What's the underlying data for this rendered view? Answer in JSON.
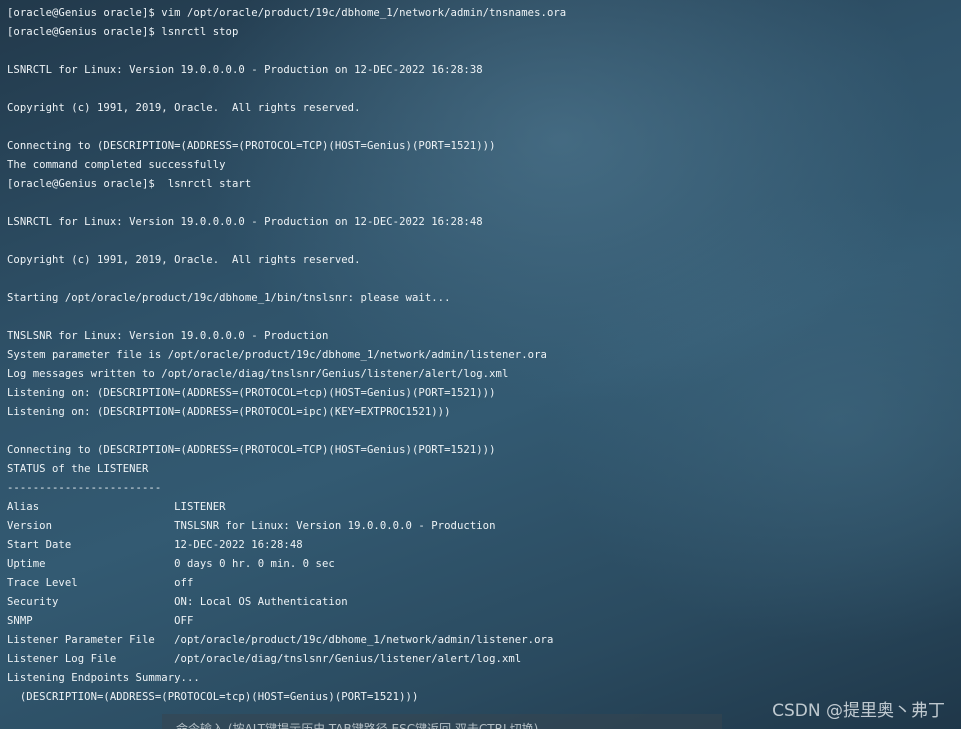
{
  "terminal": {
    "lines": [
      "[oracle@Genius oracle]$ vim /opt/oracle/product/19c/dbhome_1/network/admin/tnsnames.ora",
      "[oracle@Genius oracle]$ lsnrctl stop",
      "",
      "LSNRCTL for Linux: Version 19.0.0.0.0 - Production on 12-DEC-2022 16:28:38",
      "",
      "Copyright (c) 1991, 2019, Oracle.  All rights reserved.",
      "",
      "Connecting to (DESCRIPTION=(ADDRESS=(PROTOCOL=TCP)(HOST=Genius)(PORT=1521)))",
      "The command completed successfully",
      "[oracle@Genius oracle]$  lsnrctl start",
      "",
      "LSNRCTL for Linux: Version 19.0.0.0.0 - Production on 12-DEC-2022 16:28:48",
      "",
      "Copyright (c) 1991, 2019, Oracle.  All rights reserved.",
      "",
      "Starting /opt/oracle/product/19c/dbhome_1/bin/tnslsnr: please wait...",
      "",
      "TNSLSNR for Linux: Version 19.0.0.0.0 - Production",
      "System parameter file is /opt/oracle/product/19c/dbhome_1/network/admin/listener.ora",
      "Log messages written to /opt/oracle/diag/tnslsnr/Genius/listener/alert/log.xml",
      "Listening on: (DESCRIPTION=(ADDRESS=(PROTOCOL=tcp)(HOST=Genius)(PORT=1521)))",
      "Listening on: (DESCRIPTION=(ADDRESS=(PROTOCOL=ipc)(KEY=EXTPROC1521)))",
      "",
      "Connecting to (DESCRIPTION=(ADDRESS=(PROTOCOL=TCP)(HOST=Genius)(PORT=1521)))",
      "STATUS of the LISTENER",
      "------------------------",
      "Alias                     LISTENER",
      "Version                   TNSLSNR for Linux: Version 19.0.0.0.0 - Production",
      "Start Date                12-DEC-2022 16:28:48",
      "Uptime                    0 days 0 hr. 0 min. 0 sec",
      "Trace Level               off",
      "Security                  ON: Local OS Authentication",
      "SNMP                      OFF",
      "Listener Parameter File   /opt/oracle/product/19c/dbhome_1/network/admin/listener.ora",
      "Listener Log File         /opt/oracle/diag/tnslsnr/Genius/listener/alert/log.xml",
      "Listening Endpoints Summary...",
      "  (DESCRIPTION=(ADDRESS=(PROTOCOL=tcp)(HOST=Genius)(PORT=1521)))"
    ]
  },
  "watermark": "CSDN @提里奥丶弗丁",
  "status_bar": {
    "hint": "命令输入 (按ALT键提示历史,TAB键路径,ESC键返回,双击CTRL切换)"
  }
}
